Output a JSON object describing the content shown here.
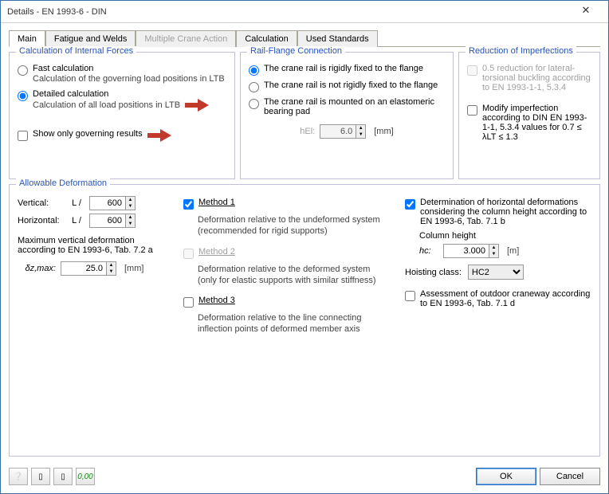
{
  "window": {
    "title": "Details - EN 1993-6 - DIN"
  },
  "tabs": [
    "Main",
    "Fatigue and Welds",
    "Multiple Crane Action",
    "Calculation",
    "Used Standards"
  ],
  "fs_internal": {
    "title": "Calculation of Internal Forces",
    "fast": {
      "label": "Fast calculation",
      "sub": "Calculation of the governing load positions in LTB"
    },
    "detailed": {
      "label": "Detailed calculation",
      "sub": "Calculation of all load positions in LTB"
    },
    "show_only": "Show only governing results"
  },
  "fs_rail": {
    "title": "Rail-Flange Connection",
    "r1": "The crane rail is rigidly fixed to the flange",
    "r2": "The crane rail is not rigidly fixed to the flange",
    "r3": "The crane rail is mounted on an elastomeric bearing pad",
    "hel_label": "hEl:",
    "hel_value": "6.0",
    "hel_unit": "[mm]"
  },
  "fs_imp": {
    "title": "Reduction of Imperfections",
    "c1": "0.5 reduction for lateral-torsional buckling according to EN 1993-1-1, 5.3.4",
    "c2": "Modify imperfection according to DIN EN 1993-1-1, 5.3.4 values for 0.7 ≤ λLT ≤ 1.3"
  },
  "fs_deform": {
    "title": "Allowable Deformation",
    "vertical": "Vertical:",
    "horizontal": "Horizontal:",
    "lslash": "L /",
    "v_val": "600",
    "h_val": "600",
    "max_vert": "Maximum vertical deformation according to EN 1993-6, Tab. 7.2 a",
    "delta_label": "δz,max:",
    "delta_val": "25.0",
    "delta_unit": "[mm]",
    "m1": {
      "t": "Method 1",
      "d": "Deformation relative to the undeformed system (recommended for rigid supports)"
    },
    "m2": {
      "t": "Method 2",
      "d": "Deformation relative to the deformed system (only for elastic supports with similar stiffness)"
    },
    "m3": {
      "t": "Method 3",
      "d": "Deformation relative to the line connecting inflection points of deformed member axis"
    },
    "det_horiz": "Determination of horizontal deformations considering the column height according to EN 1993-6, Tab. 7.1 b",
    "col_h": "Column height",
    "hc": "hc:",
    "hc_val": "3.000",
    "hc_unit": "[m]",
    "hoist_label": "Hoisting class:",
    "hoist_val": "HC2",
    "outdoor": "Assessment of outdoor craneway according to EN 1993-6, Tab. 7.1 d"
  },
  "buttons": {
    "ok": "OK",
    "cancel": "Cancel"
  }
}
